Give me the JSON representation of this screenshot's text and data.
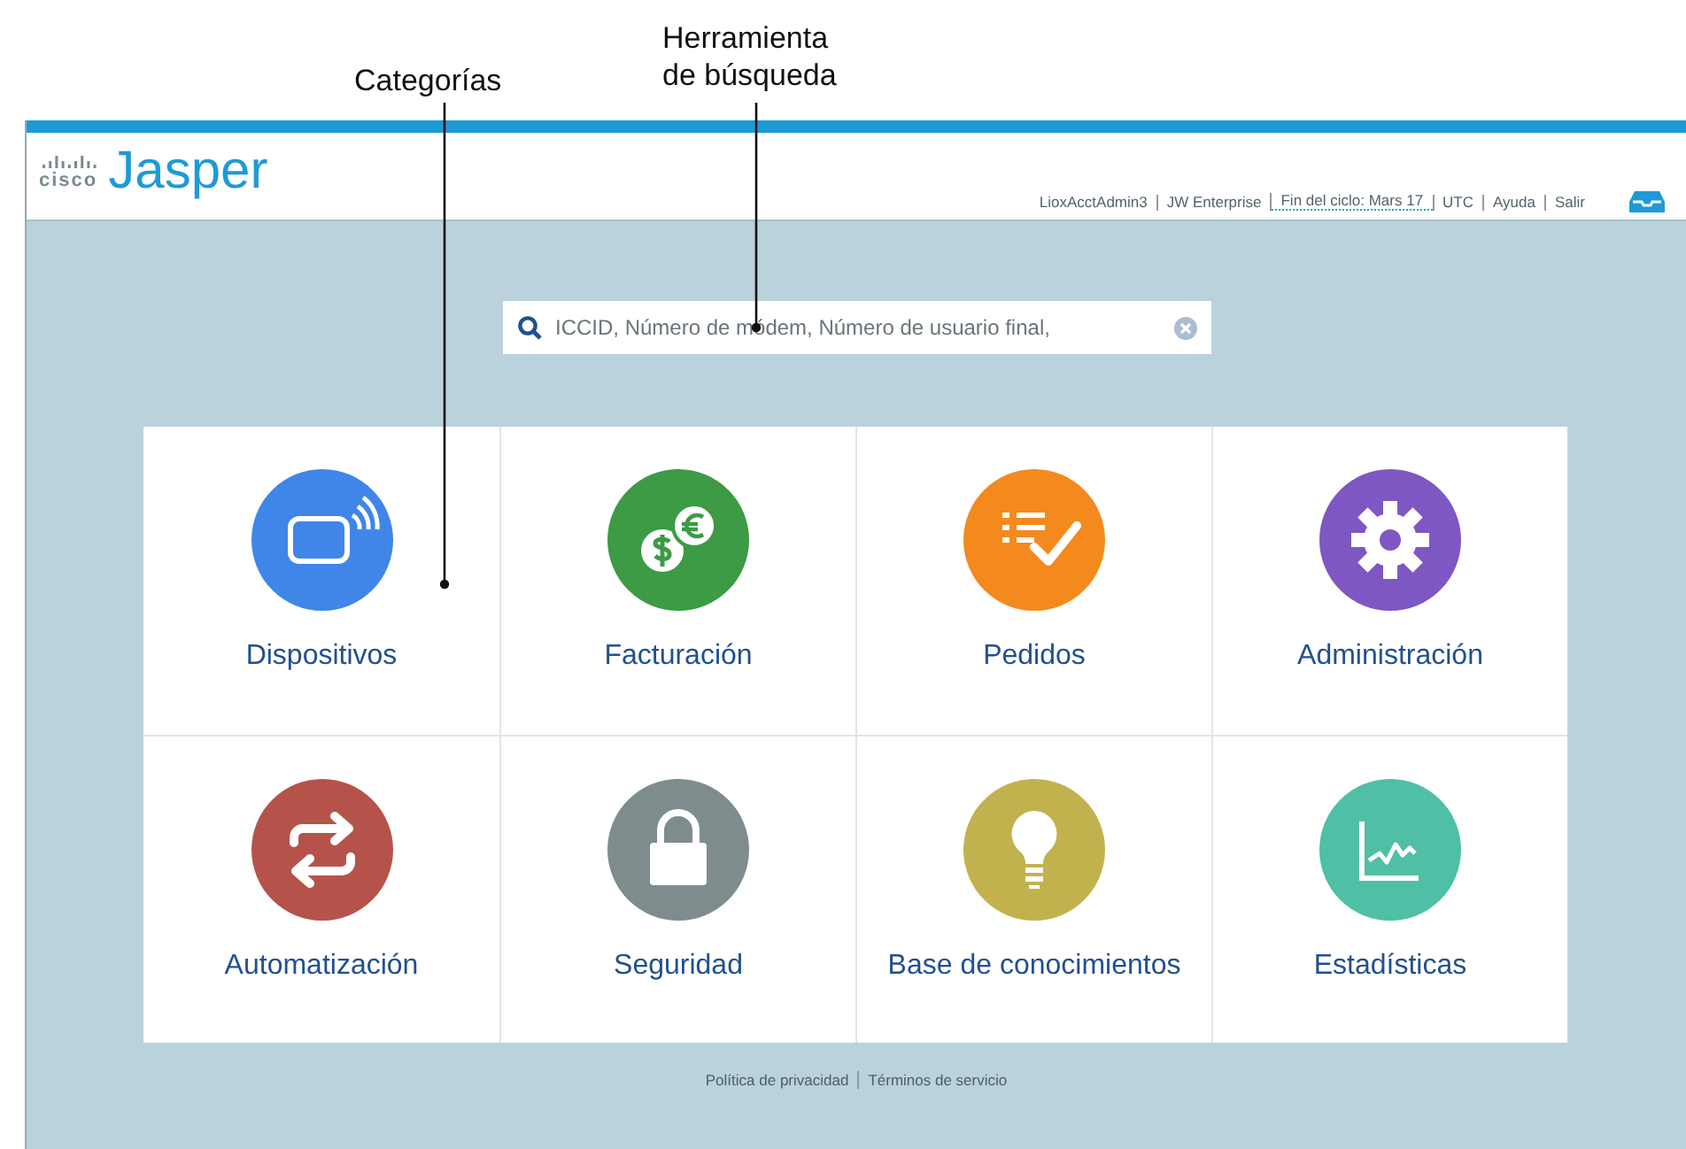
{
  "annotations": [
    {
      "label": "Categorías"
    },
    {
      "label": "Herramienta de búsqueda"
    }
  ],
  "header": {
    "logo_mark": "cisco",
    "brand": "Jasper",
    "links": [
      {
        "label": "LioxAcctAdmin3",
        "underlined": false
      },
      {
        "label": "JW Enterprise",
        "underlined": false
      },
      {
        "label": "Fin del ciclo: Mars 17",
        "underlined": true
      },
      {
        "label": "UTC",
        "underlined": false
      },
      {
        "label": "Ayuda",
        "underlined": false
      },
      {
        "label": "Salir",
        "underlined": false
      }
    ]
  },
  "search": {
    "placeholder": "ICCID, Número de módem, Número de usuario final,"
  },
  "categories": [
    {
      "label": "Dispositivos",
      "color": "#3f86e8"
    },
    {
      "label": "Facturación",
      "color": "#3d9a45"
    },
    {
      "label": "Pedidos",
      "color": "#f4891e"
    },
    {
      "label": "Administración",
      "color": "#7e57c2"
    },
    {
      "label": "Automatización",
      "color": "#b5534a"
    },
    {
      "label": "Seguridad",
      "color": "#7f8c8d"
    },
    {
      "label": "Base de conocimientos",
      "color": "#c2b24e"
    },
    {
      "label": "Estadísticas",
      "color": "#4fbfa5"
    }
  ],
  "footer": {
    "links": [
      "Política de privacidad",
      "Términos de servicio"
    ]
  }
}
